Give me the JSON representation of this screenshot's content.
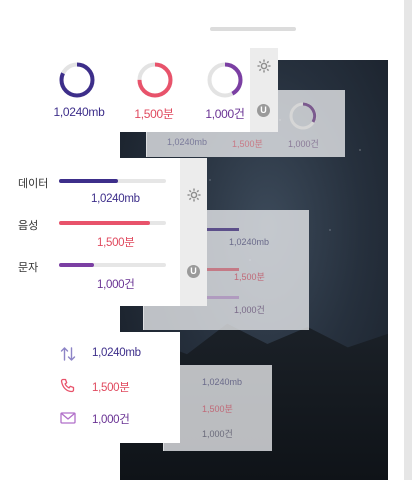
{
  "colors": {
    "data": "#3d2e8a",
    "voice": "#e8536b",
    "text": "#7b3fa3",
    "voice_text": "#e04a5f",
    "text_text": "#6a3394"
  },
  "usage_rings": [
    {
      "id": "data",
      "label": "1,0240mb",
      "fraction": 0.82
    },
    {
      "id": "voice",
      "label": "1,500분",
      "fraction": 0.75
    },
    {
      "id": "text",
      "label": "1,000건",
      "fraction": 0.42
    }
  ],
  "bars": [
    {
      "id": "data",
      "title": "데이터",
      "value": "1,0240mb",
      "fraction": 0.55
    },
    {
      "id": "voice",
      "title": "음성",
      "value": "1,500분",
      "fraction": 0.85
    },
    {
      "id": "text",
      "title": "문자",
      "value": "1,000건",
      "fraction": 0.33
    }
  ],
  "list": [
    {
      "id": "data",
      "icon": "arrows-up-down-icon",
      "value": "1,0240mb"
    },
    {
      "id": "voice",
      "icon": "phone-icon",
      "value": "1,500분"
    },
    {
      "id": "text",
      "icon": "envelope-icon",
      "value": "1,000건"
    }
  ],
  "ghost": {
    "top": [
      "1,0240mb",
      "1,500분",
      "1,000건"
    ],
    "mid": [
      "1,0240mb",
      "1,500분",
      "1,000건"
    ],
    "bot": [
      "1,0240mb",
      "1,500분",
      "1,000건"
    ]
  },
  "badge_letter": "U"
}
